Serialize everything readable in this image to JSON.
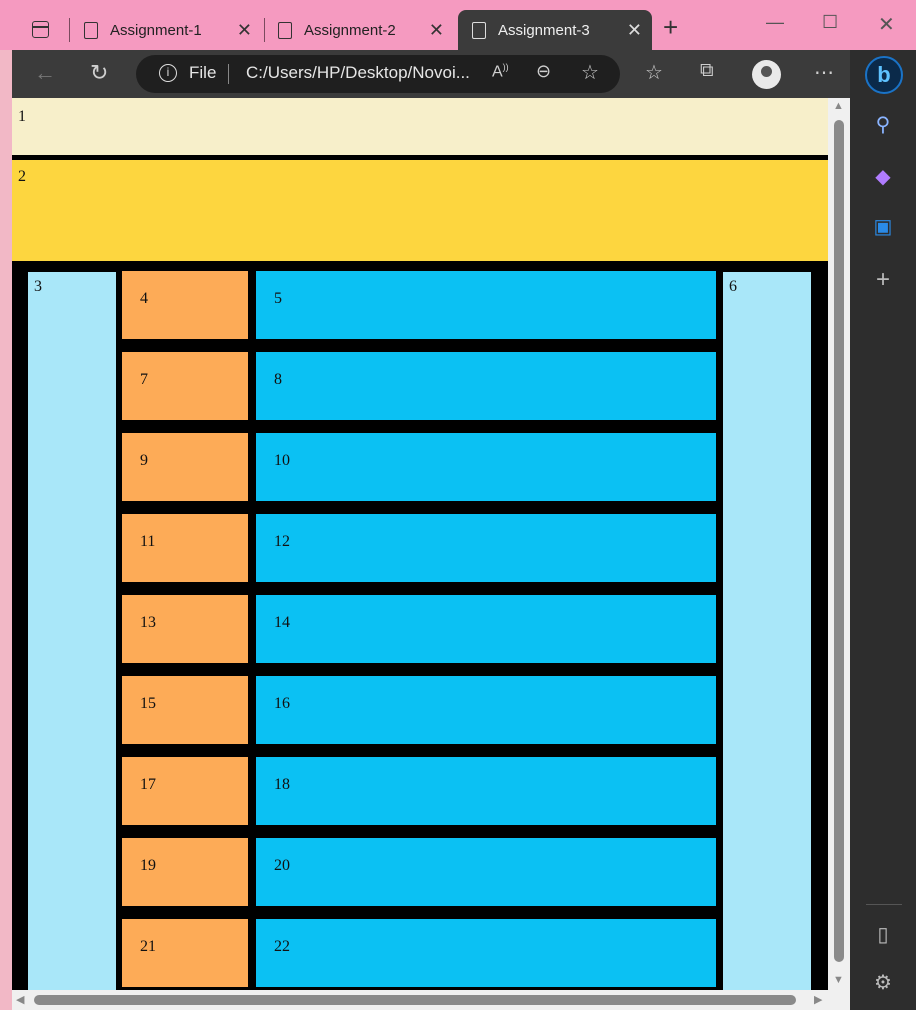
{
  "browser": {
    "tabs": [
      {
        "label": "Assignment-1",
        "active": false
      },
      {
        "label": "Assignment-2",
        "active": false
      },
      {
        "label": "Assignment-3",
        "active": true
      }
    ],
    "address": {
      "scheme_label": "File",
      "url": "C:/Users/HP/Desktop/Novoi..."
    },
    "window_controls": {
      "minimize": "—",
      "maximize": "☐",
      "close": "✕"
    },
    "icons": {
      "back": "back-arrow-icon",
      "refresh": "refresh-icon",
      "read_aloud": "read-aloud-icon",
      "zoom": "zoom-out-icon",
      "favorite_add": "add-favorite-icon",
      "favorites": "favorites-icon",
      "collections": "collections-icon",
      "profile": "profile-icon",
      "more": "more-icon",
      "bing": "bing-copilot-icon",
      "search": "search-icon",
      "copilot": "copilot-icon",
      "outlook": "outlook-icon",
      "add": "add-icon",
      "sidebar_toggle": "sidebar-toggle-icon",
      "settings": "settings-icon"
    }
  },
  "page": {
    "box1": "1",
    "box2": "2",
    "box3": "3",
    "box6": "6",
    "rows": [
      {
        "left": "4",
        "right": "5"
      },
      {
        "left": "7",
        "right": "8"
      },
      {
        "left": "9",
        "right": "10"
      },
      {
        "left": "11",
        "right": "12"
      },
      {
        "left": "13",
        "right": "14"
      },
      {
        "left": "15",
        "right": "16"
      },
      {
        "left": "17",
        "right": "18"
      },
      {
        "left": "19",
        "right": "20"
      },
      {
        "left": "21",
        "right": "22"
      }
    ],
    "colors": {
      "box1": "#f7efca",
      "box2": "#fdd63f",
      "side": "#a9e7f9",
      "left_cells": "#fdab57",
      "right_cells": "#0bc1f3",
      "background": "#000000"
    }
  }
}
